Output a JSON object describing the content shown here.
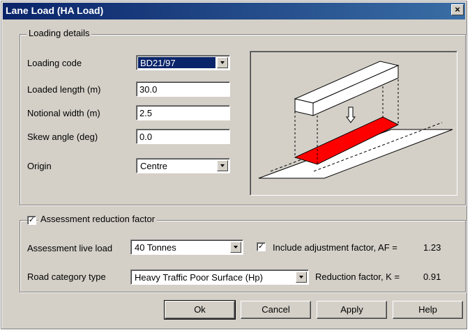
{
  "window": {
    "title": "Lane Load (HA Load)",
    "close_glyph": "×"
  },
  "loading_details": {
    "legend": "Loading details",
    "loading_code": {
      "label": "Loading code",
      "value": "BD21/97"
    },
    "loaded_length": {
      "label": "Loaded length (m)",
      "value": "30.0"
    },
    "notional_width": {
      "label": "Notional width (m)",
      "value": "2.5"
    },
    "skew_angle": {
      "label": "Skew angle (deg)",
      "value": "0.0"
    },
    "origin": {
      "label": "Origin",
      "value": "Centre"
    }
  },
  "assessment": {
    "legend": "Assessment reduction factor",
    "checked": true,
    "live_load": {
      "label": "Assessment live load",
      "value": "40 Tonnes"
    },
    "include_af": {
      "label": "Include adjustment factor, AF =",
      "checked": true,
      "value": "1.23"
    },
    "road_category": {
      "label": "Road category type",
      "value": "Heavy Traffic Poor Surface (Hp)"
    },
    "reduction_factor": {
      "label": "Reduction factor, K =",
      "value": "0.91"
    }
  },
  "buttons": {
    "ok": "Ok",
    "cancel": "Cancel",
    "apply": "Apply",
    "help": "Help"
  },
  "colors": {
    "title_bar": "#0a246a",
    "load_area": "#ff0000",
    "dialog_bg": "#d4d0c8"
  },
  "icons": {
    "close": "close-icon",
    "dropdown": "chevron-down-icon",
    "check": "checkmark-icon"
  }
}
